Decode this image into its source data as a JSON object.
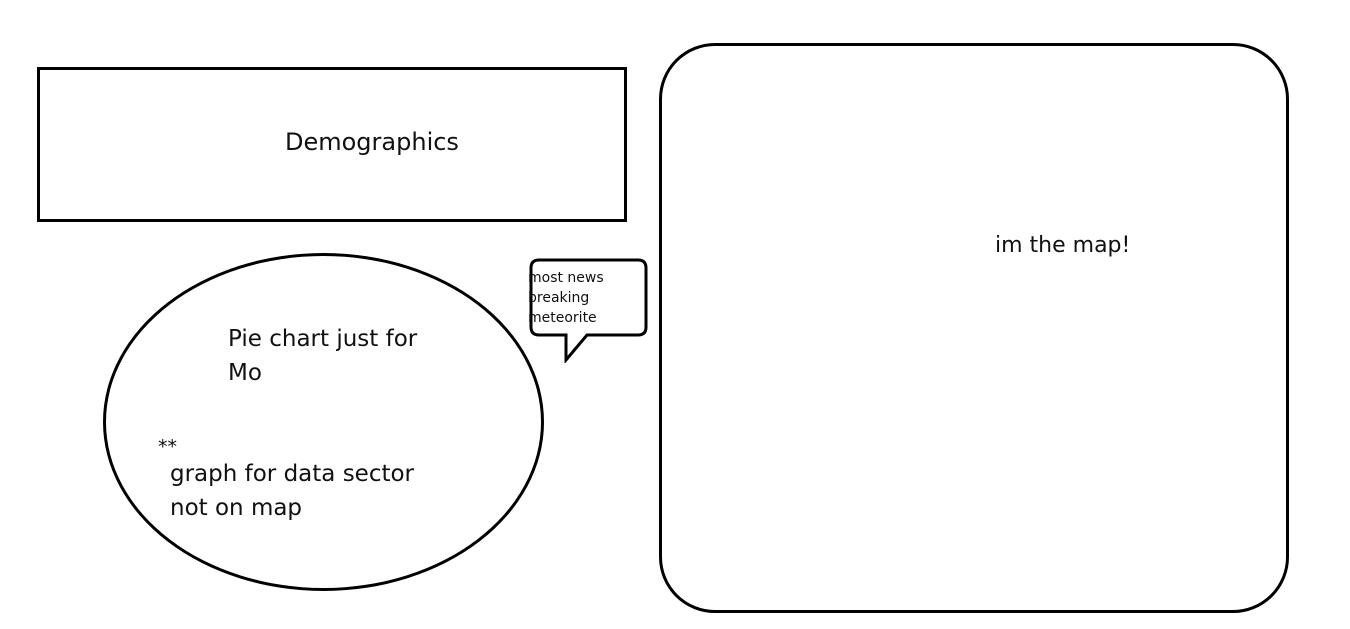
{
  "demographics": {
    "label": "Demographics"
  },
  "map": {
    "label": "im the map!"
  },
  "pie": {
    "label": "Pie chart just for Mo",
    "stars": "**",
    "note": "graph for data sector not on map"
  },
  "callout": {
    "text": "most news breaking meteorite"
  }
}
